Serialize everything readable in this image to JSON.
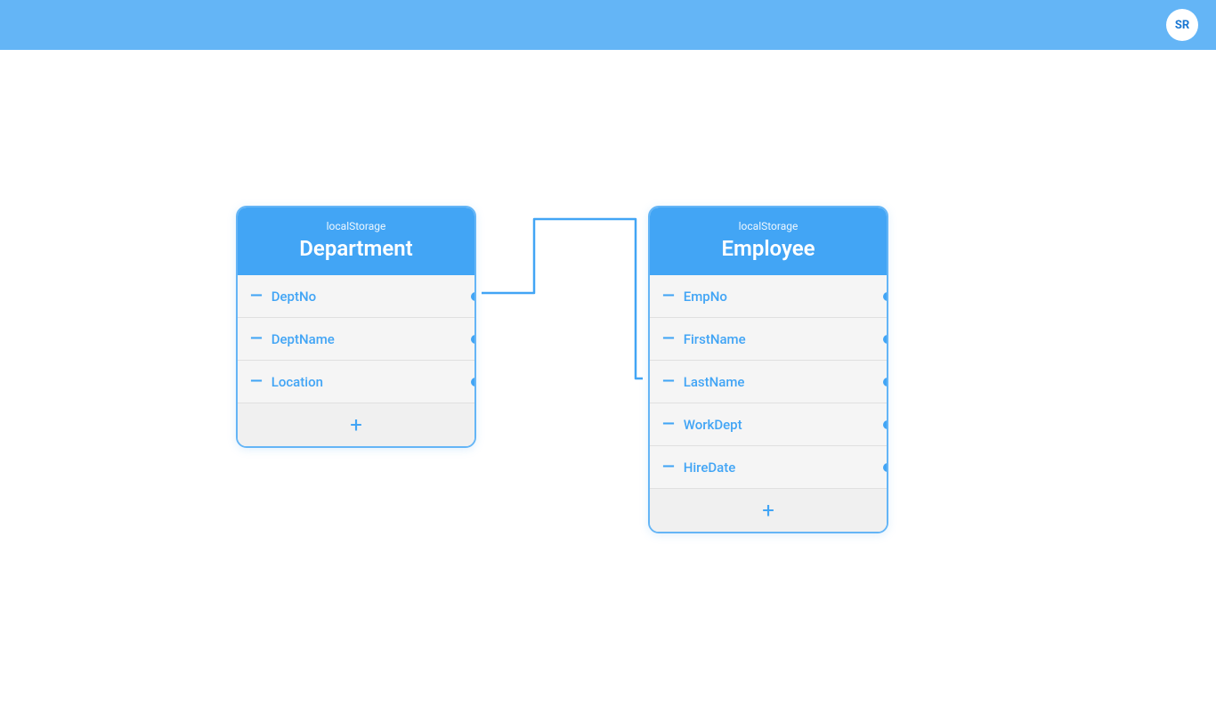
{
  "topbar": {
    "avatar_initials": "SR"
  },
  "department_table": {
    "source": "localStorage",
    "name": "Department",
    "fields": [
      {
        "name": "DeptNo"
      },
      {
        "name": "DeptName"
      },
      {
        "name": "Location"
      }
    ],
    "add_label": "+"
  },
  "employee_table": {
    "source": "localStorage",
    "name": "Employee",
    "fields": [
      {
        "name": "EmpNo"
      },
      {
        "name": "FirstName"
      },
      {
        "name": "LastName"
      },
      {
        "name": "WorkDept"
      },
      {
        "name": "HireDate"
      }
    ],
    "add_label": "+"
  },
  "connector": {
    "from": "DeptNo",
    "to": "LastName"
  }
}
